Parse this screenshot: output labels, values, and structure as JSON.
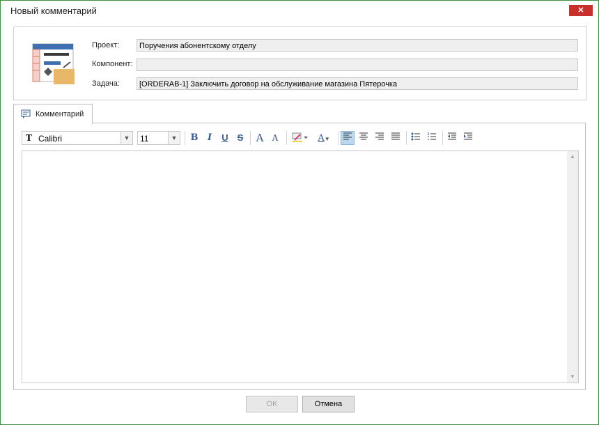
{
  "window": {
    "title": "Новый комментарий",
    "close_label": "✕"
  },
  "fields": {
    "project_label": "Проект:",
    "project_value": "Поручения абонентскому отделу",
    "component_label": "Компонент:",
    "component_value": "",
    "task_label": "Задача:",
    "task_value": "[ORDERAB-1] Заключить договор на обслуживание магазина Пятерочка"
  },
  "tab": {
    "label": "Комментарий",
    "icon": "comment-icon"
  },
  "toolbar": {
    "font_name": "Calibri",
    "font_size": "11",
    "bold": "B",
    "italic": "I",
    "underline": "U",
    "strike": "S",
    "grow_font": "A",
    "shrink_font": "A",
    "font_color": "A",
    "active_alignment": "left"
  },
  "editor": {
    "content": ""
  },
  "buttons": {
    "ok_label": "OK",
    "cancel_label": "Отмена"
  },
  "colors": {
    "accent": "#3a5c8c",
    "close": "#c7302b",
    "border": "#3c8c3c"
  }
}
